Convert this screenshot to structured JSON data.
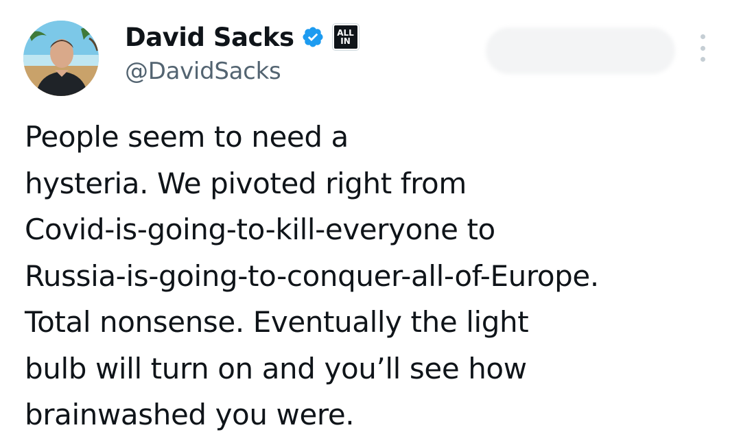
{
  "author": {
    "display_name": "David Sacks",
    "handle": "@DavidSacks",
    "verified": true,
    "affiliate_badge": [
      "ALL",
      "IN"
    ],
    "avatar": "profile-photo"
  },
  "tweet": {
    "lines": [
      "People seem to need a",
      "hysteria. We pivoted right from",
      "Covid-is-going-to-kill-everyone to",
      "Russia-is-going-to-conquer-all-of-Europe.",
      "Total nonsense. Eventually the light",
      "bulb will turn on and you’ll see how",
      "brainwashed you were."
    ]
  },
  "icons": {
    "verified": "verified-badge-icon",
    "more": "more-options-icon"
  },
  "colors": {
    "verified_blue": "#1d9bf0",
    "text": "#0f1419",
    "muted": "#536471"
  }
}
